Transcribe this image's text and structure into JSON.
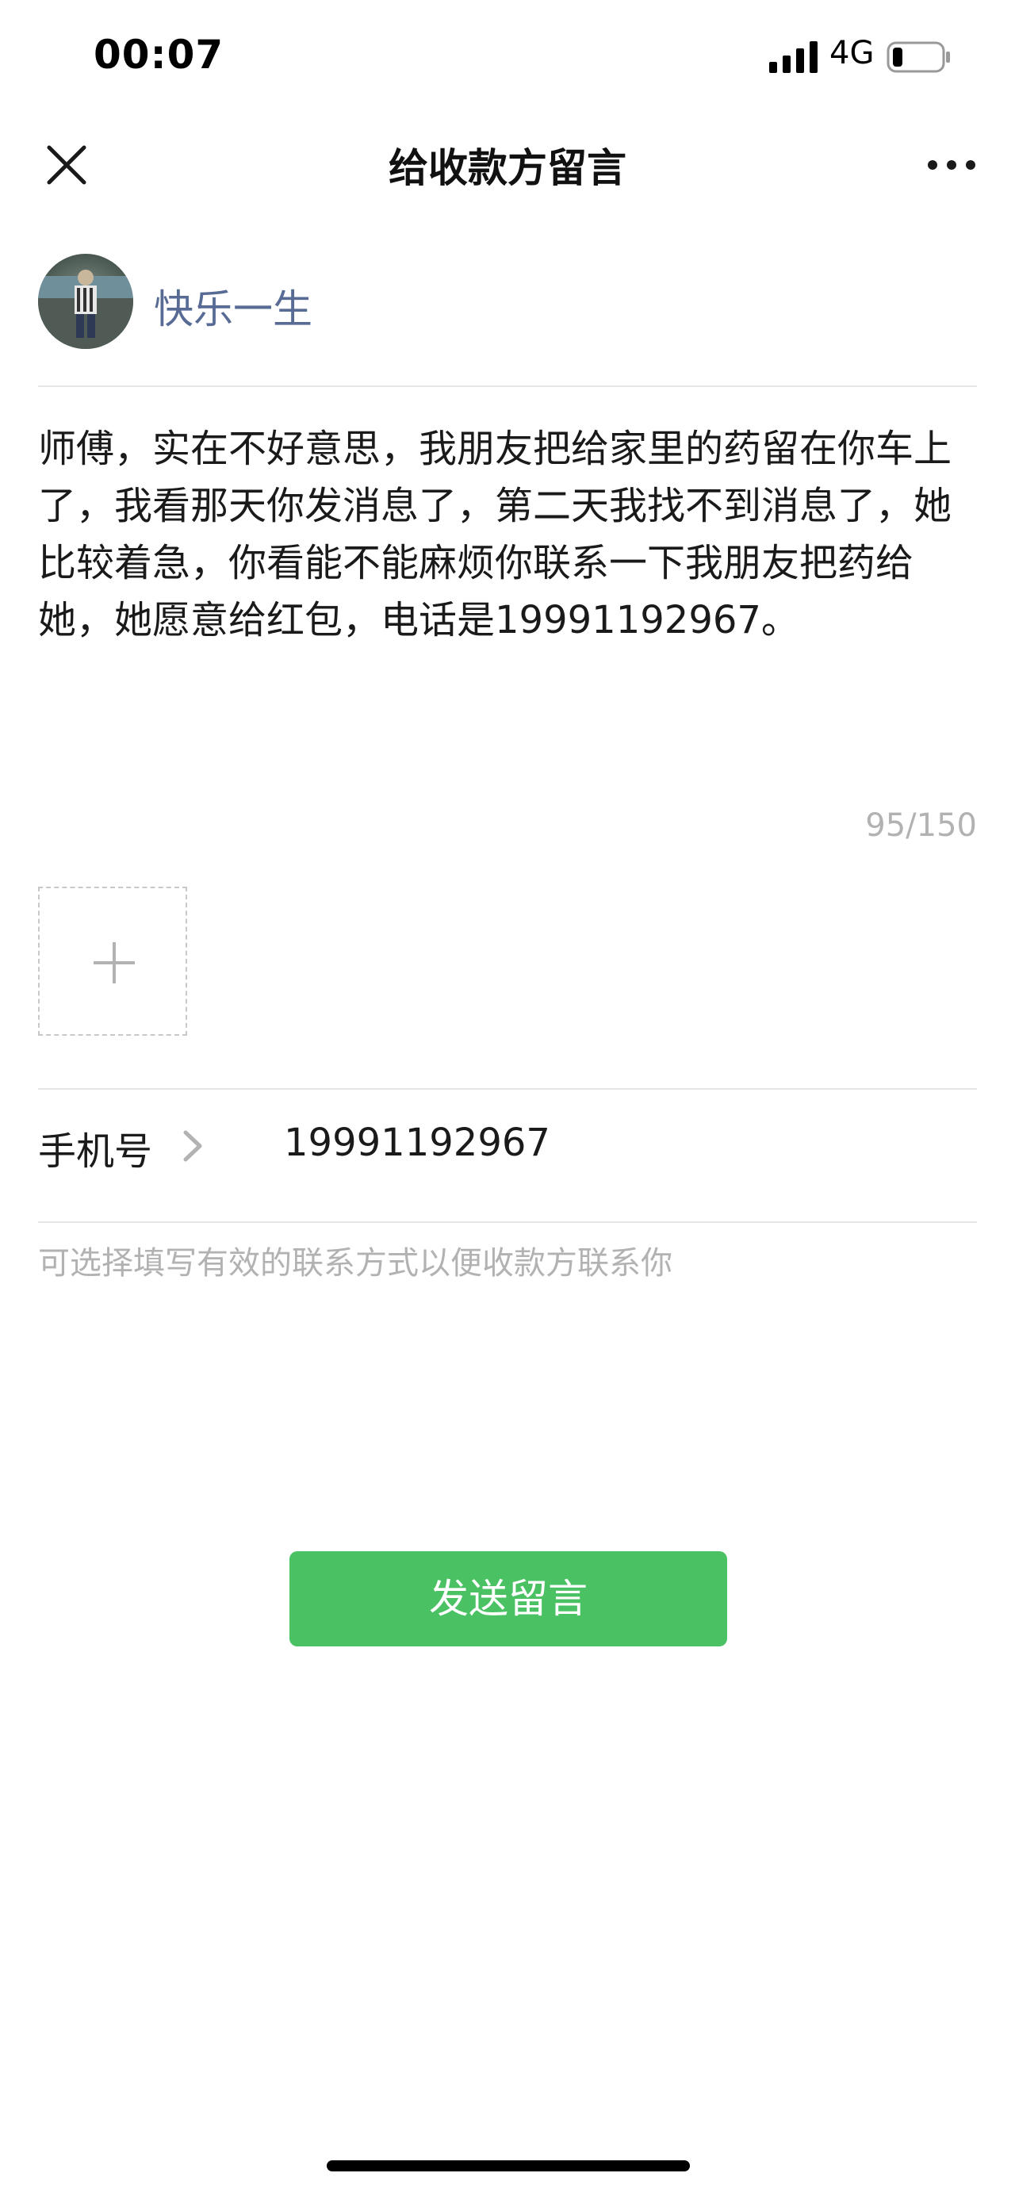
{
  "status_bar": {
    "time": "00:07",
    "network": "4G"
  },
  "nav": {
    "title": "给收款方留言",
    "close_icon": "close-icon",
    "more_icon": "more-dots-icon"
  },
  "payee": {
    "name": "快乐一生",
    "avatar_icon": "avatar"
  },
  "message": {
    "text": "师傅，实在不好意思，我朋友把给家里的药留在你车上了，我看那天你发消息了，第二天我找不到消息了，她比较着急，你看能不能麻烦你联系一下我朋友把药给她，她愿意给红包，电话是19991192967。",
    "char_count": "95/150"
  },
  "add_image": {
    "icon": "plus-icon"
  },
  "phone": {
    "label": "手机号",
    "value": "19991192967",
    "hint": "可选择填写有效的联系方式以便收款方联系你"
  },
  "send_button": {
    "label": "发送留言"
  },
  "colors": {
    "accent_green": "#4ac264",
    "link_blue": "#576b95",
    "hint_gray": "#b2b2b2"
  }
}
